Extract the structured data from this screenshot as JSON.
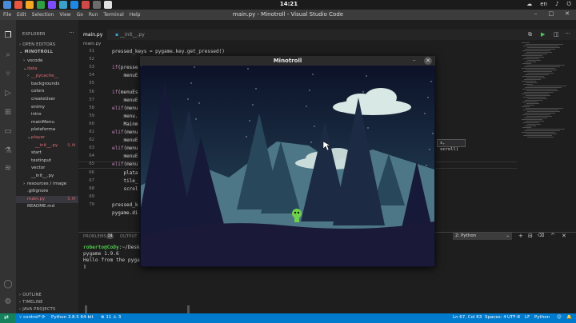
{
  "system": {
    "clock": "14:21",
    "indicators": [
      "☁",
      "en",
      "♪",
      "⏻"
    ],
    "accent_colors": [
      "#4c8bd6",
      "#e8563f",
      "#f5a623",
      "#2f9e44",
      "#7c4dff",
      "#d04848",
      "#3aa1c9",
      "#6b6b6b",
      "#1e88e5",
      "#e0e0e0"
    ]
  },
  "menubar": {
    "items": [
      "File",
      "Edit",
      "Selection",
      "View",
      "Go",
      "Run",
      "Terminal",
      "Help"
    ],
    "window_title": "main.py - Minotroll - Visual Studio Code",
    "controls": [
      "–",
      "□",
      "✕"
    ]
  },
  "explorer": {
    "title": "EXPLORER",
    "open_editors": "OPEN EDITORS",
    "project": "MINOTROLL",
    "items": [
      {
        "label": "vscode",
        "arrow": "›",
        "color": "#cccccc",
        "indent": 1
      },
      {
        "label": "data",
        "arrow": "⌄",
        "color": "#e06c75",
        "indent": 1
      },
      {
        "label": "__pycache__",
        "arrow": "›",
        "color": "#e06c75",
        "indent": 2
      },
      {
        "label": "backgrounds",
        "arrow": "",
        "color": "#cccccc",
        "indent": 2
      },
      {
        "label": "colors",
        "arrow": "",
        "color": "#cccccc",
        "indent": 2
      },
      {
        "label": "createUser",
        "arrow": "",
        "color": "#cccccc",
        "indent": 2
      },
      {
        "label": "enimy",
        "arrow": "",
        "color": "#cccccc",
        "indent": 2
      },
      {
        "label": "intro",
        "arrow": "",
        "color": "#cccccc",
        "indent": 2
      },
      {
        "label": "mainMenu",
        "arrow": "",
        "color": "#cccccc",
        "indent": 2
      },
      {
        "label": "plataforma",
        "arrow": "",
        "color": "#cccccc",
        "indent": 2
      },
      {
        "label": "player",
        "arrow": "⌄",
        "color": "#e06c75",
        "indent": 2
      },
      {
        "label": "__init__.py",
        "arrow": "",
        "color": "#e06c75",
        "indent": 3,
        "badge": "5, M"
      },
      {
        "label": "start",
        "arrow": "",
        "color": "#cccccc",
        "indent": 2
      },
      {
        "label": "textinput",
        "arrow": "",
        "color": "#cccccc",
        "indent": 2
      },
      {
        "label": "vector",
        "arrow": "",
        "color": "#cccccc",
        "indent": 2
      },
      {
        "label": "__init__.py",
        "arrow": "",
        "color": "#cccccc",
        "indent": 2
      },
      {
        "label": "resources / image",
        "arrow": "›",
        "color": "#cccccc",
        "indent": 1
      },
      {
        "label": ".gitignore",
        "arrow": "",
        "color": "#cccccc",
        "indent": 1
      },
      {
        "label": "main.py",
        "arrow": "",
        "color": "#e06c75",
        "indent": 1,
        "badge": "5, M",
        "selected": true
      },
      {
        "label": "README.md",
        "arrow": "",
        "color": "#cccccc",
        "indent": 1
      }
    ],
    "footer": [
      "OUTLINE",
      "TIMELINE",
      "JAVA PROJECTS"
    ]
  },
  "editor": {
    "tabs": [
      {
        "label": "main.py",
        "active": true
      },
      {
        "label": "__init__.py",
        "active": false
      }
    ],
    "breadcrumb": "main.py",
    "line_numbers": [
      "51",
      "52",
      "53",
      "54",
      "55",
      "56",
      "57",
      "58",
      "59",
      "60",
      "61",
      "62",
      "63",
      "64",
      "65",
      "66",
      "67",
      "68",
      "69",
      "70"
    ],
    "code": [
      {
        "indent": "",
        "text": "pressed_keys = pygame.key.get_pressed()",
        "kw": ""
      },
      {
        "indent": "",
        "text": "",
        "kw": ""
      },
      {
        "indent": "",
        "text": "(presse",
        "kw": "if"
      },
      {
        "indent": "    ",
        "text": "menuE",
        "kw": ""
      },
      {
        "indent": "",
        "text": "",
        "kw": ""
      },
      {
        "indent": "",
        "text": "(menuEs",
        "kw": "if"
      },
      {
        "indent": "    ",
        "text": "menuE",
        "kw": ""
      },
      {
        "indent": "",
        "text": "(menu",
        "kw": "elif"
      },
      {
        "indent": "    ",
        "text": "menu.",
        "kw": ""
      },
      {
        "indent": "    ",
        "text": "Mainm",
        "kw": ""
      },
      {
        "indent": "",
        "text": "(menu",
        "kw": "elif"
      },
      {
        "indent": "    ",
        "text": "menuE",
        "kw": ""
      },
      {
        "indent": "",
        "text": "(menu",
        "kw": "elif"
      },
      {
        "indent": "    ",
        "text": "menuE",
        "kw": ""
      },
      {
        "indent": "",
        "text": "(menu",
        "kw": "elif"
      },
      {
        "indent": "    ",
        "text": "plata",
        "kw": ""
      },
      {
        "indent": "    ",
        "text": "tile_",
        "kw": ""
      },
      {
        "indent": "    ",
        "text": "scrol",
        "kw": ""
      },
      {
        "indent": "",
        "text": "",
        "kw": ""
      },
      {
        "indent": "",
        "text": "pressed_k",
        "kw": ""
      },
      {
        "indent": "",
        "text": "pygame.di",
        "kw": ""
      }
    ],
    "tooltip": "s, scroll)"
  },
  "panel": {
    "tabs": [
      "PROBLEMS",
      "OUTPUT"
    ],
    "problems_count": "14",
    "terminal_select": "2: Python",
    "terminal_lines": {
      "prompt": "roberto@CoDy",
      "prompt_rest": ":~/Desk",
      "line2": "pygame 1.9.6",
      "line3": "Hello from the pyga",
      "cursor": "▯"
    },
    "icons": [
      "+",
      "⊟",
      "🗑",
      "^",
      "✕"
    ]
  },
  "game_window": {
    "title": "Minotroll",
    "minimize": "–",
    "close": "✕",
    "colors": {
      "sky_top": "#0c1228",
      "sky_bottom": "#2b4f63",
      "mountain": "#4d7686",
      "tree_far": "#29475a",
      "tree_mid": "#1d2a44",
      "tree_near": "#161937",
      "ground": "#1a1a38",
      "cloud": "#d8e8e4",
      "player": "#6fd14b"
    }
  },
  "statusbar": {
    "branch": "control*",
    "sync": "⟳",
    "python": "Python 3.8.5 64-bit",
    "errors": "⊗ 11 ⚠ 3",
    "position": "Ln 67, Col 63",
    "spaces": "Spaces: 4",
    "encoding": "UTF-8",
    "eol": "LF",
    "language": "Python",
    "icons": [
      "☺",
      "🔔"
    ]
  }
}
